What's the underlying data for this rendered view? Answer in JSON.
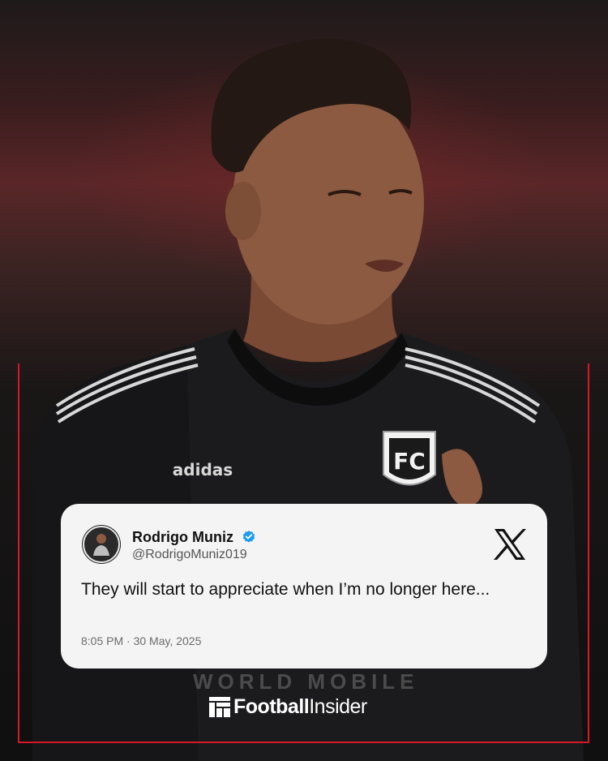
{
  "post": {
    "author_name": "Rodrigo Muniz",
    "handle": "@RodrigoMuniz019",
    "text": "They will start to appreciate when I’m no longer here...",
    "timestamp": "8:05 PM · 30 May, 2025",
    "platform_icon": "x-logo-icon",
    "verified_icon": "verified-badge-icon"
  },
  "photo": {
    "kit_brand": "adidas",
    "shirt_sponsor": "WORLD MOBILE"
  },
  "brand": {
    "name_bold": "Football",
    "name_regular": "Insider"
  },
  "colors": {
    "frame": "#d7182a",
    "card": "#f4f4f4",
    "verified": "#1d9bf0"
  }
}
